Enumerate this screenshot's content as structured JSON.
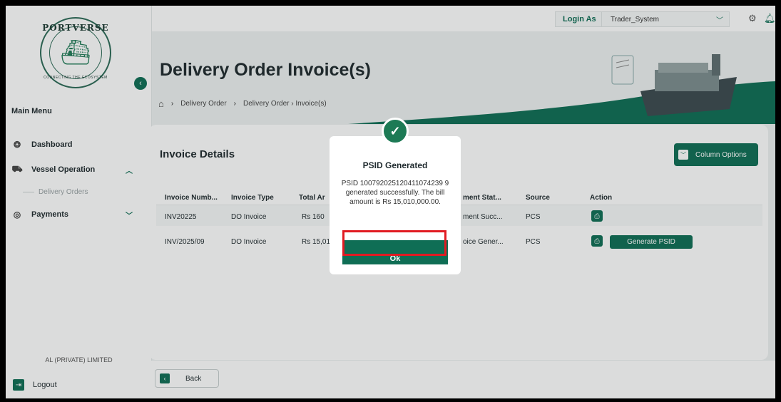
{
  "sidebar": {
    "logo_top": "PORTVERSE",
    "logo_bottom": "CONNECTING THE ECOSYSTEM",
    "main_menu": "Main Menu",
    "items": [
      {
        "label": "Dashboard",
        "icon": "dashboard-icon"
      },
      {
        "label": "Vessel Operation",
        "icon": "ship-icon"
      },
      {
        "label": "Payments",
        "icon": "payments-icon"
      }
    ],
    "sub_item": "Delivery Orders",
    "company": "AL (PRIVATE) LIMITED",
    "logout": "Logout"
  },
  "topbar": {
    "login_as": "Login As",
    "role": "Trader_System"
  },
  "page": {
    "title": "Delivery Order Invoice(s)",
    "breadcrumb": [
      "Delivery Order",
      "Delivery Order › Invoice(s)"
    ]
  },
  "card": {
    "title": "Invoice Details",
    "column_options": "Column Options",
    "columns": [
      "Invoice Numb...",
      "Invoice Type",
      "Total Ar",
      "ment Stat...",
      "Source",
      "Action"
    ],
    "rows": [
      {
        "invoice": "INV20225",
        "type": "DO Invoice",
        "total": "Rs 160",
        "status": "ment Succ...",
        "source": "PCS"
      },
      {
        "invoice": "INV/2025/09",
        "type": "DO Invoice",
        "total": "Rs 15,01",
        "status": "oice Gener...",
        "source": "PCS",
        "action": "Generate PSID"
      }
    ]
  },
  "footer": {
    "back": "Back"
  },
  "modal": {
    "title": "PSID Generated",
    "message": "PSID 100792025120411074239 9 generated successfully. The bill amount is Rs 15,010,000.00.",
    "ok": "Ok"
  },
  "colors": {
    "primary": "#0f6e55",
    "highlight": "#e11b22"
  }
}
